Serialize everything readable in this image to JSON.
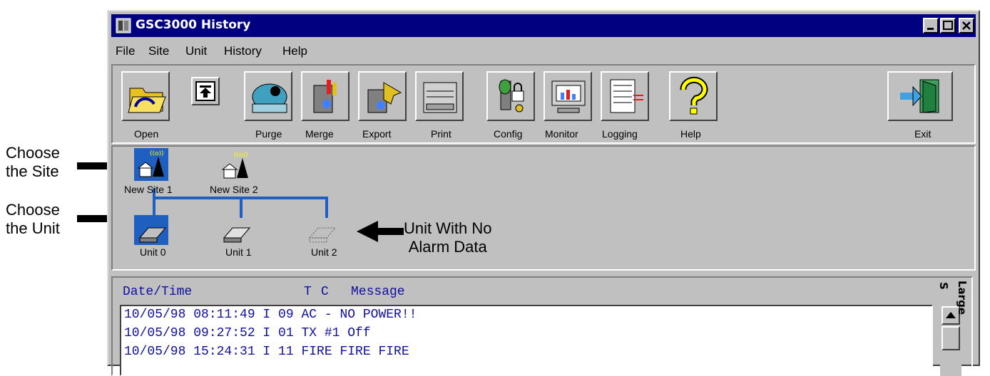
{
  "annotations": {
    "choose_site": [
      "Choose",
      "the Site"
    ],
    "choose_unit": [
      "Choose",
      "the Unit"
    ],
    "no_alarm": [
      "Unit With No",
      "Alarm Data"
    ]
  },
  "window": {
    "title": "GSC3000 History"
  },
  "menu": [
    "File",
    "Site",
    "Unit",
    "History",
    "Help"
  ],
  "toolbar": {
    "open": "Open",
    "purge": "Purge",
    "merge": "Merge",
    "export": "Export",
    "print": "Print",
    "config": "Config",
    "monitor": "Monitor",
    "logging": "Logging",
    "help": "Help",
    "exit": "Exit"
  },
  "sites": [
    {
      "label": "New Site 1",
      "selected": true
    },
    {
      "label": "New Site 2",
      "selected": false
    }
  ],
  "units": [
    {
      "label": "Unit 0",
      "selected": true
    },
    {
      "label": "Unit 1",
      "selected": false
    },
    {
      "label": "Unit 2",
      "selected": false
    }
  ],
  "log": {
    "headers": {
      "datetime": "Date/Time",
      "t": "T",
      "c": "C",
      "message": "Message"
    },
    "rows": [
      "10/05/98 08:11:49 I 09 AC - NO POWER!!",
      "10/05/98 09:27:52 I 01 TX #1 Off",
      "10/05/98 15:24:31 I 11 FIRE FIRE FIRE"
    ],
    "side_labels": {
      "small": "S",
      "large": "Large"
    }
  },
  "colors": {
    "titlebar": "#000080",
    "selection": "#1f5fbf",
    "log_text": "#1010a0"
  }
}
